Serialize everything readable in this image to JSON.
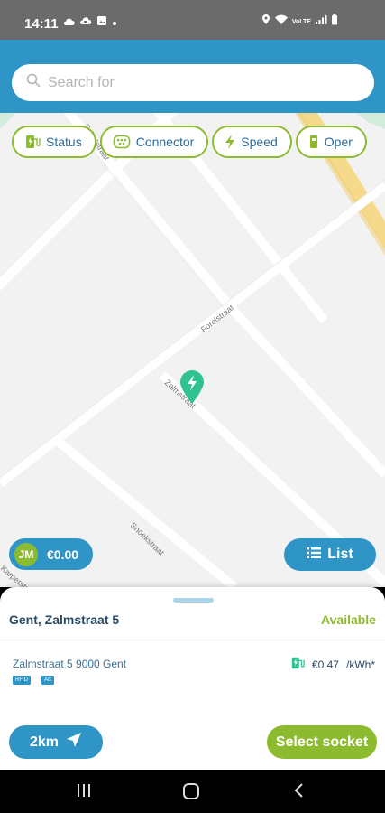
{
  "status_bar": {
    "time": "14:11",
    "left_icons": [
      "cloud-icon",
      "cloud-message-icon",
      "image-icon",
      "dot-icon"
    ],
    "right_icons": [
      "location-icon",
      "wifi-icon",
      "volte-icon",
      "signal-icon",
      "battery-icon"
    ],
    "volte_text": "VoLTE"
  },
  "search": {
    "placeholder": "Search for"
  },
  "filters": [
    {
      "label": "Status",
      "icon": "charging-station-icon"
    },
    {
      "label": "Connector",
      "icon": "connector-icon"
    },
    {
      "label": "Speed",
      "icon": "lightning-icon"
    },
    {
      "label": "Oper",
      "icon": "operator-icon"
    }
  ],
  "map": {
    "streets": [
      "Schotstraat",
      "Forelstraat",
      "Zalmstraat",
      "Snoekstraat",
      "Karperstraat"
    ],
    "marker": "charging-marker-icon"
  },
  "wallet": {
    "initials": "JM",
    "balance": "€0.00"
  },
  "list_button": {
    "label": "List"
  },
  "location_card": {
    "title": "Gent, Zalmstraat 5",
    "availability": "Available",
    "address": "Zalmstraat 5 9000 Gent",
    "tags": [
      "RFID",
      "AC"
    ],
    "price": "€0.47",
    "unit": "/kWh*"
  },
  "distance_button": {
    "label": "2km"
  },
  "select_button": {
    "label": "Select socket"
  },
  "colors": {
    "primary": "#2e95c6",
    "accent": "#8dbb2f",
    "text_dark": "#2b4a66"
  }
}
